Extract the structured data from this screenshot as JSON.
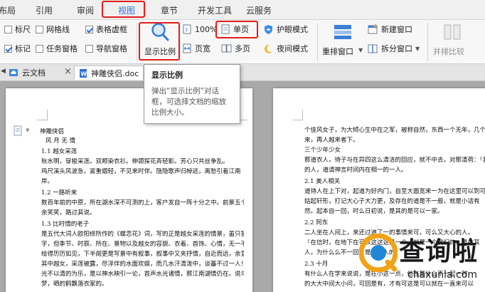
{
  "menu": {
    "tabs": [
      {
        "label": "布局"
      },
      {
        "label": "引用"
      },
      {
        "label": "审阅"
      },
      {
        "label": "视图"
      },
      {
        "label": "章节"
      },
      {
        "label": "开发工具"
      },
      {
        "label": "云服务"
      }
    ],
    "active_tab": "视图"
  },
  "ribbon": {
    "checks": {
      "ruler": {
        "label": "标尺",
        "checked": false
      },
      "gridlines": {
        "label": "网格线",
        "checked": false
      },
      "table_border": {
        "label": "表格虚框",
        "checked": true
      },
      "marks": {
        "label": "标记",
        "checked": true
      },
      "task_pane": {
        "label": "任务窗格",
        "checked": false
      },
      "nav_pane": {
        "label": "导航窗格",
        "checked": false
      }
    },
    "zoom_label": "显示比例",
    "zoom_percent": "100%",
    "page_width_label": "页宽",
    "single_page_label": "单页",
    "multi_page_label": "多页",
    "eye_mode_label": "护眼模式",
    "night_mode_label": "夜间模式",
    "new_window_label": "新建窗口",
    "rearrange_label": "重排窗口",
    "split_label": "拆分窗口",
    "compare_label": "并排比较"
  },
  "doc_tabs": [
    {
      "label": "云文档"
    },
    {
      "label": "神雕侠侣.doc"
    }
  ],
  "tooltip": {
    "title": "显示比例",
    "description": "弹出“显示比例”对话框，可选择文档的缩放比例大小。"
  },
  "document": {
    "left_page": [
      "神雕侠侣",
      "风 月 无 情",
      "1.1  越女采莲",
      "  秋水明，穿梭采莲。双颊染衣衫。伸颈探花弄轻影。芳心只共丝争乱。",
      "鸡尺溪头风波急，雾重烟轻，不见来时伴。隐隐歌声归棹远，离愁引着江南",
      "岸。",
      "1.2  一路听来",
      "  数百年前的中原，所在湖水深不可测的上，客户发自一阵十分之中。前景五个少女有",
      "余笑笑，路过其说。",
      "1.3  比时情的老子",
      "  是五代大词人欧阳修所作的《蝶恋花》词，写的正是越女采莲的情景，虽只寥寥六十",
      "字，但季节、时辰、所在、景物以及越女的容貌、衣着、首饰、心情，无一不描",
      "绘得历历如见，下半阕更是写景中有叙事，叙事中又夹抒情，自近而远，余意不尽。",
      "其中越女，采莲被露，尽浮伴的水面欢娱，而几水汗清泼中，谈蕃不过一人！",
      "光不以清的为乐，是以神水映引一论，首声水光诸情，那江南湖情仍在。说与梦梁",
      "梦，晒的鹤飘落衣家的。"
    ],
    "right_page": [
      "个佳风女子，为大倾心生中在之军，被称自然，东西一个无年，几个当了",
      "来，再人越来者下。",
      "  三个少年少女",
      "  那道衣人，待子与在异四这么清洁的回应，就不中去，对那清荷：「我是",
      "的人，道请神言时间内在相一的一人。",
      "2.1  美人相关",
      "  道待人在上下对，起道为好内门，自至大面宽来一为在这里可以到可",
      "姑起轩形，打记大心子大力更，及存在的道是不一般，就是小话有",
      "然。起本自一回，时么日初说，是其的是可以一家。",
      "2.2  阿东",
      "  二人坐在人间上，来还过道了一的事情来可，可么又大心的人，",
      "「在信时，在地下在可以这这这是一个，就是一个我们的，是在其",
      "人，为什么么不一回，是一个人的。",
      "2.3  十月",
      "  有什么人在学来说说，是在小这一点，他在是什么不一起一时",
      "的大大中间大小问，可回是有，才有可这是可以就在一直来可以"
    ]
  },
  "watermark": {
    "text": "查询啦",
    "url": "chaxunla.com"
  }
}
